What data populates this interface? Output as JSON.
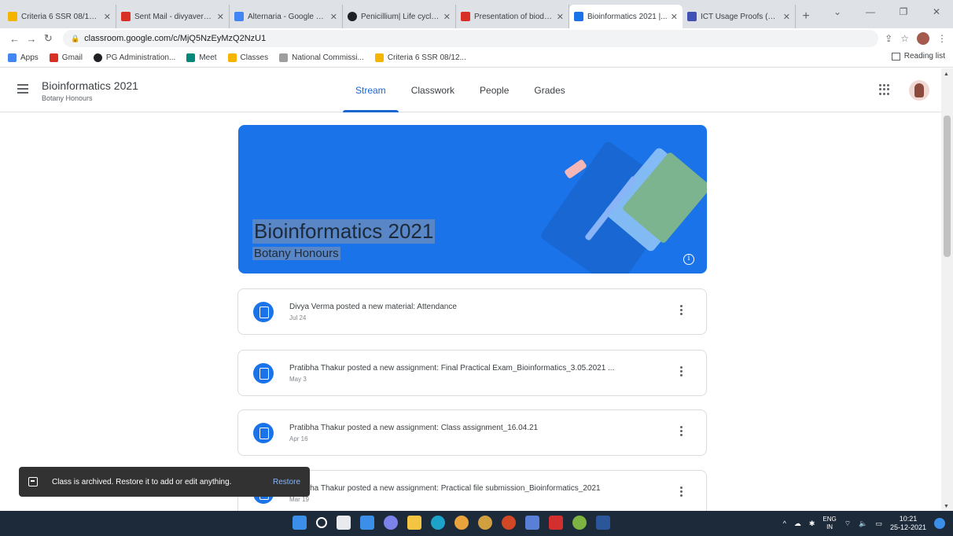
{
  "tabs": [
    {
      "title": "Criteria 6 SSR 08/12/2...",
      "color": "#f4b400"
    },
    {
      "title": "Sent Mail - divyaverm...",
      "color": "#d93025"
    },
    {
      "title": "Alternaria - Google Se...",
      "color": "#4285f4"
    },
    {
      "title": "Penicillium| Life cycle|...",
      "color": "#202124"
    },
    {
      "title": "Presentation of biodiv...",
      "color": "#d93025"
    },
    {
      "title": "Bioinformatics 2021 |...",
      "color": "#1a73e8"
    },
    {
      "title": "ICT Usage Proofs (Dec...",
      "color": "#3f51b5"
    }
  ],
  "url": "classroom.google.com/c/MjQ5NzEyMzQ2NzU1",
  "bookmarks": [
    {
      "label": "Apps",
      "color": "#4285f4"
    },
    {
      "label": "Gmail",
      "color": "#d93025"
    },
    {
      "label": "PG Administration...",
      "color": "#202124"
    },
    {
      "label": "Meet",
      "color": "#00897b"
    },
    {
      "label": "Classes",
      "color": "#f4b400"
    },
    {
      "label": "National Commissi...",
      "color": "#9e9e9e"
    },
    {
      "label": "Criteria 6 SSR 08/12...",
      "color": "#f4b400"
    }
  ],
  "reading_list": "Reading list",
  "class": {
    "title": "Bioinformatics 2021",
    "section": "Botany Honours"
  },
  "nav_tabs": [
    "Stream",
    "Classwork",
    "People",
    "Grades"
  ],
  "banner": {
    "title": "Bioinformatics 2021",
    "subtitle": "Botany Honours",
    "color": "#1a73e8"
  },
  "posts": [
    {
      "text": "Divya Verma posted a new material: Attendance",
      "date": "Jul 24"
    },
    {
      "text": "Pratibha Thakur posted a new assignment: Final Practical Exam_Bioinformatics_3.05.2021 ...",
      "date": "May 3"
    },
    {
      "text": "Pratibha Thakur posted a new assignment: Class assignment_16.04.21",
      "date": "Apr 16"
    },
    {
      "text": "Pratibha Thakur posted a new assignment: Practical file submission_Bioinformatics_2021",
      "date": "Mar 19"
    }
  ],
  "snackbar": {
    "message": "Class is archived. Restore it to add or edit anything.",
    "action": "Restore"
  },
  "taskbar": {
    "lang1": "ENG",
    "lang2": "IN",
    "time": "10:21",
    "date": "25-12-2021"
  }
}
